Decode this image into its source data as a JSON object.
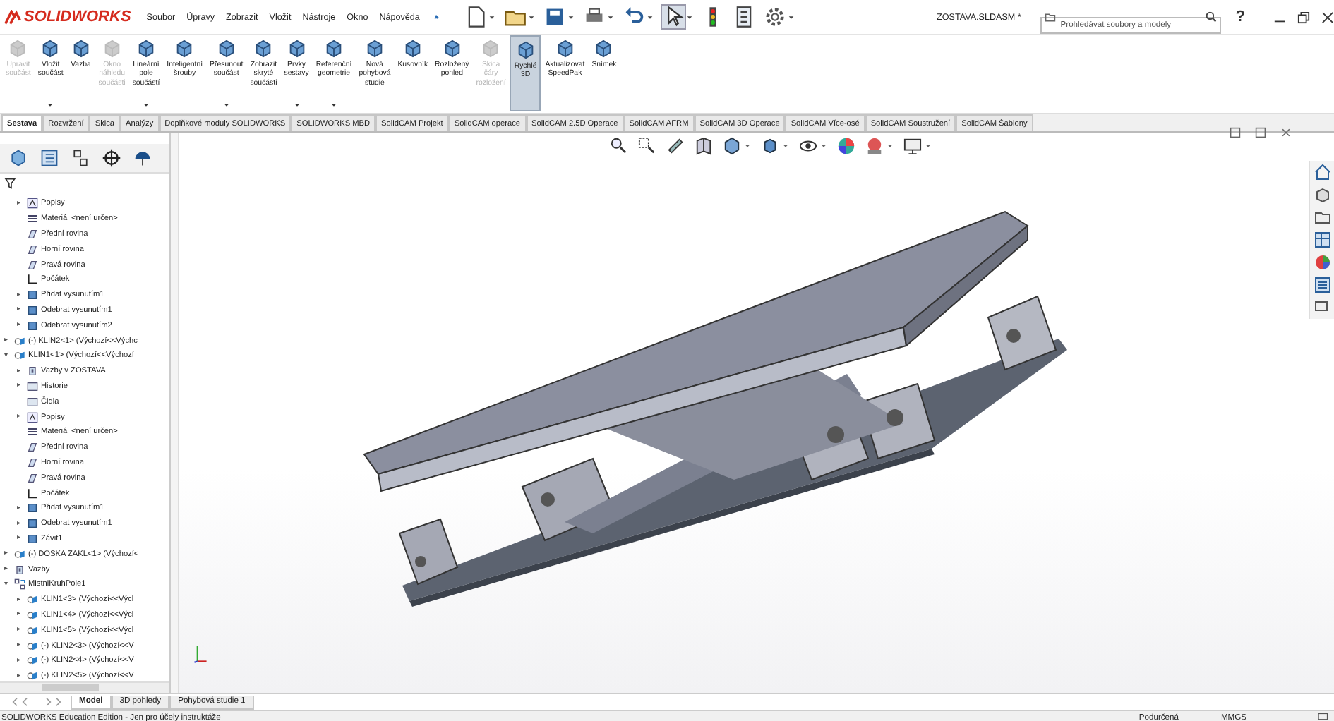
{
  "app": {
    "logo": "SOLIDWORKS",
    "menu": [
      "Soubor",
      "Úpravy",
      "Zobrazit",
      "Vložit",
      "Nástroje",
      "Okno",
      "Nápověda"
    ],
    "title": "ZOSTAVA.SLDASM *",
    "search": {
      "placeholder": "Prohledávat soubory a modely"
    },
    "help": "?"
  },
  "ribbon": {
    "commands": [
      {
        "label": "Upravit\nsoučást",
        "disabled": true,
        "selected": false,
        "dropdown": false
      },
      {
        "label": "Vložit\nsoučást",
        "disabled": false,
        "selected": false,
        "dropdown": true
      },
      {
        "label": "Vazba",
        "disabled": false,
        "selected": false,
        "dropdown": false
      },
      {
        "label": "Okno\nnáhledu\nsoučásti",
        "disabled": true,
        "selected": false,
        "dropdown": false
      },
      {
        "label": "Lineární\npole\nsoučástí",
        "disabled": false,
        "selected": false,
        "dropdown": true
      },
      {
        "label": "Inteligentní\nšrouby",
        "disabled": false,
        "selected": false,
        "dropdown": false
      },
      {
        "label": "Přesunout\nsoučást",
        "disabled": false,
        "selected": false,
        "dropdown": true
      },
      {
        "label": "Zobrazit\nskryté\nsoučásti",
        "disabled": false,
        "selected": false,
        "dropdown": false
      },
      {
        "label": "Prvky\nsestavy",
        "disabled": false,
        "selected": false,
        "dropdown": true
      },
      {
        "label": "Referenční\ngeometrie",
        "disabled": false,
        "selected": false,
        "dropdown": true
      },
      {
        "label": "Nová\npohybová\nstudie",
        "disabled": false,
        "selected": false,
        "dropdown": false
      },
      {
        "label": "Kusovník",
        "disabled": false,
        "selected": false,
        "dropdown": false
      },
      {
        "label": "Rozložený\npohled",
        "disabled": false,
        "selected": false,
        "dropdown": false
      },
      {
        "label": "Skica\nčáry\nrozložení",
        "disabled": true,
        "selected": false,
        "dropdown": false
      },
      {
        "label": "Rychlé\n3D",
        "disabled": false,
        "selected": true,
        "dropdown": false
      },
      {
        "label": "Aktualizovat\nSpeedPak",
        "disabled": false,
        "selected": false,
        "dropdown": false
      },
      {
        "label": "Snímek",
        "disabled": false,
        "selected": false,
        "dropdown": false
      }
    ]
  },
  "tabs": [
    {
      "label": "Sestava",
      "selected": true
    },
    {
      "label": "Rozvržení",
      "selected": false
    },
    {
      "label": "Skica",
      "selected": false
    },
    {
      "label": "Analýzy",
      "selected": false
    },
    {
      "label": "Doplňkové moduly SOLIDWORKS",
      "selected": false
    },
    {
      "label": "SOLIDWORKS MBD",
      "selected": false
    },
    {
      "label": "SolidCAM Projekt",
      "selected": false
    },
    {
      "label": "SolidCAM operace",
      "selected": false
    },
    {
      "label": "SolidCAM 2.5D Operace",
      "selected": false
    },
    {
      "label": "SolidCAM AFRM",
      "selected": false
    },
    {
      "label": "SolidCAM 3D Operace",
      "selected": false
    },
    {
      "label": "SolidCAM Více-osé",
      "selected": false
    },
    {
      "label": "SolidCAM Soustružení",
      "selected": false
    },
    {
      "label": "SolidCAM Šablony",
      "selected": false
    }
  ],
  "tree": {
    "partial_items": [
      {
        "label": "Popisy",
        "kind": "annotations",
        "arrow": "▸"
      },
      {
        "label": "Materiál <není určen>",
        "kind": "material"
      },
      {
        "label": "Přední rovina",
        "kind": "plane"
      },
      {
        "label": "Horní rovina",
        "kind": "plane"
      },
      {
        "label": "Pravá rovina",
        "kind": "plane"
      },
      {
        "label": "Počátek",
        "kind": "origin"
      },
      {
        "label": "Přidat vysunutím1",
        "kind": "feature",
        "arrow": "▸"
      },
      {
        "label": "Odebrat vysunutím1",
        "kind": "feature",
        "arrow": "▸"
      },
      {
        "label": "Odebrat vysunutím2",
        "kind": "feature",
        "arrow": "▸"
      }
    ],
    "items": [
      {
        "label": "(-) KLIN2<1> (Výchozí<<Výchc",
        "kind": "component",
        "arrow": "▸"
      },
      {
        "label": "KLIN1<1> (Výchozí<<Výchozí",
        "kind": "component",
        "arrow": "▾",
        "children": [
          {
            "label": "Vazby v ZOSTAVA",
            "kind": "mates",
            "arrow": "▸"
          },
          {
            "label": "Historie",
            "kind": "folder",
            "arrow": "▸"
          },
          {
            "label": "Čidla",
            "kind": "folder"
          },
          {
            "label": "Popisy",
            "kind": "annotations",
            "arrow": "▸"
          },
          {
            "label": "Materiál <není určen>",
            "kind": "material"
          },
          {
            "label": "Přední rovina",
            "kind": "plane"
          },
          {
            "label": "Horní rovina",
            "kind": "plane"
          },
          {
            "label": "Pravá rovina",
            "kind": "plane"
          },
          {
            "label": "Počátek",
            "kind": "origin"
          },
          {
            "label": "Přidat vysunutím1",
            "kind": "feature",
            "arrow": "▸"
          },
          {
            "label": "Odebrat vysunutím1",
            "kind": "feature",
            "arrow": "▸"
          },
          {
            "label": "Závit1",
            "kind": "feature",
            "arrow": "▸"
          }
        ]
      },
      {
        "label": "(-) DOSKA ZAKL<1> (Výchozí<",
        "kind": "component",
        "arrow": "▸"
      },
      {
        "label": "Vazby",
        "kind": "mates",
        "arrow": "▸"
      },
      {
        "label": "MistniKruhPole1",
        "kind": "pattern",
        "arrow": "▾",
        "children": [
          {
            "label": "KLIN1<3> (Výchozí<<Výcl",
            "kind": "component",
            "arrow": "▸"
          },
          {
            "label": "KLIN1<4> (Výchozí<<Výcl",
            "kind": "component",
            "arrow": "▸"
          },
          {
            "label": "KLIN1<5> (Výchozí<<Výcl",
            "kind": "component",
            "arrow": "▸"
          },
          {
            "label": "(-) KLIN2<3> (Výchozí<<V",
            "kind": "component",
            "arrow": "▸"
          },
          {
            "label": "(-) KLIN2<4> (Výchozí<<V",
            "kind": "component",
            "arrow": "▸"
          },
          {
            "label": "(-) KLIN2<5> (Výchozí<<V",
            "kind": "component",
            "arrow": "▸"
          }
        ]
      }
    ]
  },
  "bottom_tabs": [
    {
      "label": "Model",
      "selected": true
    },
    {
      "label": "3D pohledy",
      "selected": false
    },
    {
      "label": "Pohybová studie 1",
      "selected": false
    }
  ],
  "status_bar": {
    "edition": "SOLIDWORKS Education Edition - Jen pro účely instruktáže",
    "state": "Podurčená",
    "units": "MMGS"
  }
}
